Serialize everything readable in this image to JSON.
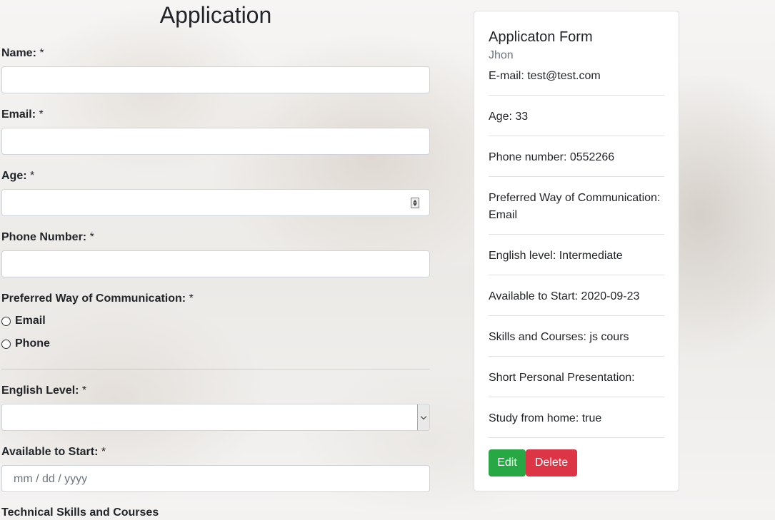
{
  "form": {
    "title": "Application",
    "required_marker": "*",
    "fields": {
      "name": {
        "label": "Name:",
        "value": ""
      },
      "email": {
        "label": "Email:",
        "value": ""
      },
      "age": {
        "label": "Age:",
        "value": ""
      },
      "phone": {
        "label": "Phone Number:",
        "value": ""
      },
      "communication": {
        "label": "Preferred Way of Communication:",
        "options": [
          "Email",
          "Phone"
        ]
      },
      "english_level": {
        "label": "English Level:",
        "value": ""
      },
      "available_start": {
        "label": "Available to Start:",
        "placeholder": "mm / dd / yyyy"
      },
      "technical_skills": {
        "label": "Technical Skills and Courses"
      }
    }
  },
  "summary_card": {
    "title": "Applicaton Form",
    "name": "Jhon",
    "items": [
      "E-mail: test@test.com",
      "Age: 33",
      "Phone number: 0552266",
      "Preferred Way of Communication: Email",
      "English level: Intermediate",
      "Available to Start: 2020-09-23",
      "Skills and Courses: js cours",
      "Short Personal Presentation:",
      "Study from home: true"
    ],
    "buttons": {
      "edit": "Edit",
      "delete": "Delete"
    }
  },
  "colors": {
    "edit_button": "#28a745",
    "delete_button": "#dc3545",
    "muted_text": "#6c757d"
  }
}
